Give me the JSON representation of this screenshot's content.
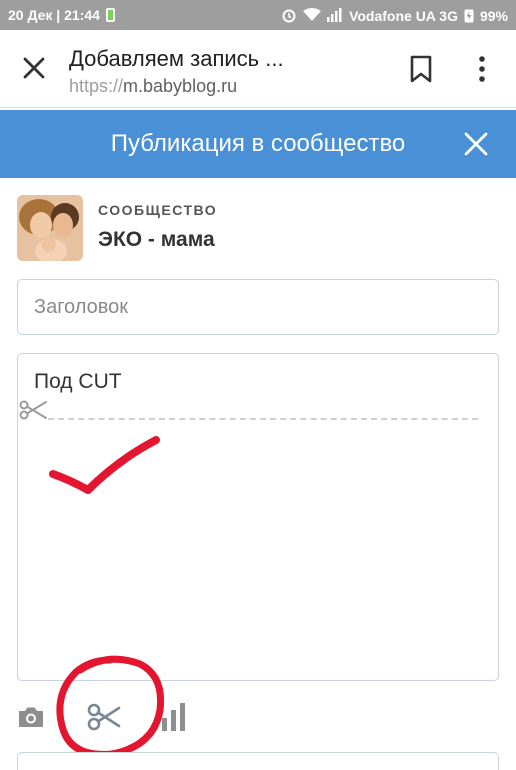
{
  "status_bar": {
    "datetime": "20 Дек | 21:44",
    "carrier": "Vodafone UA 3G",
    "battery": "99%",
    "icons": [
      "battery-icon",
      "alarm-icon",
      "wifi-icon",
      "signal-icon",
      "charging-icon"
    ]
  },
  "browser": {
    "title": "Добавляем запись ...",
    "url_scheme": "https://",
    "url_host": "m.babyblog.ru",
    "icons": [
      "close-icon",
      "bookmark-icon",
      "more-vert-icon"
    ]
  },
  "publication": {
    "header_title": "Публикация в сообщество",
    "community_label": "СООБЩЕСТВО",
    "community_name": "ЭКО - мама",
    "title_placeholder": "Заголовок",
    "editor_text": "Под CUT"
  },
  "toolbar": {
    "icons": [
      "camera-icon",
      "scissors-icon",
      "poll-icon"
    ]
  },
  "colors": {
    "header_blue": "#4a90d6",
    "status_bar_gray": "#9e9e9e",
    "annotation_red": "#e4152f",
    "border": "#c7d3de"
  }
}
